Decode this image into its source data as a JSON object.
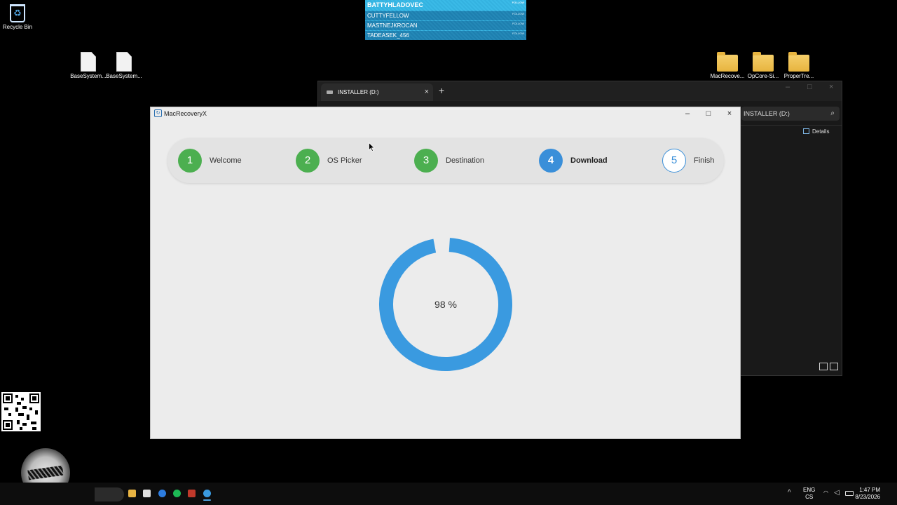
{
  "desktop": {
    "recycle_bin": "Recycle Bin",
    "files": [
      "BaseSystem...",
      "BaseSystem..."
    ],
    "folders": [
      "MacRecove...",
      "OpCore-Si...",
      "ProperTre..."
    ]
  },
  "stream_overlay": {
    "names": [
      "BATTYHLADOVEC",
      "CUTTYFELLOW",
      "MASTNEJKROCAN",
      "TADEASEK_456"
    ],
    "follow_label": "FOLLOW"
  },
  "explorer": {
    "tab_title": "INSTALLER (D:)",
    "address": "INSTALLER (D:)",
    "details_label": "Details"
  },
  "app": {
    "title": "MacRecoveryX",
    "steps": [
      {
        "number": "1",
        "label": "Welcome",
        "state": "done"
      },
      {
        "number": "2",
        "label": "OS Picker",
        "state": "done"
      },
      {
        "number": "3",
        "label": "Destination",
        "state": "done"
      },
      {
        "number": "4",
        "label": "Download",
        "state": "active"
      },
      {
        "number": "5",
        "label": "Finish",
        "state": "todo"
      }
    ],
    "progress": {
      "percent": 98,
      "label": "98 %"
    },
    "colors": {
      "done": "#4caf50",
      "active": "#3a8fd9",
      "ring": "#3a9ae0"
    }
  },
  "taskbar": {
    "lang_line1": "ENG",
    "lang_line2": "CS",
    "time": "1:47 PM",
    "date": "8/23/2026"
  }
}
